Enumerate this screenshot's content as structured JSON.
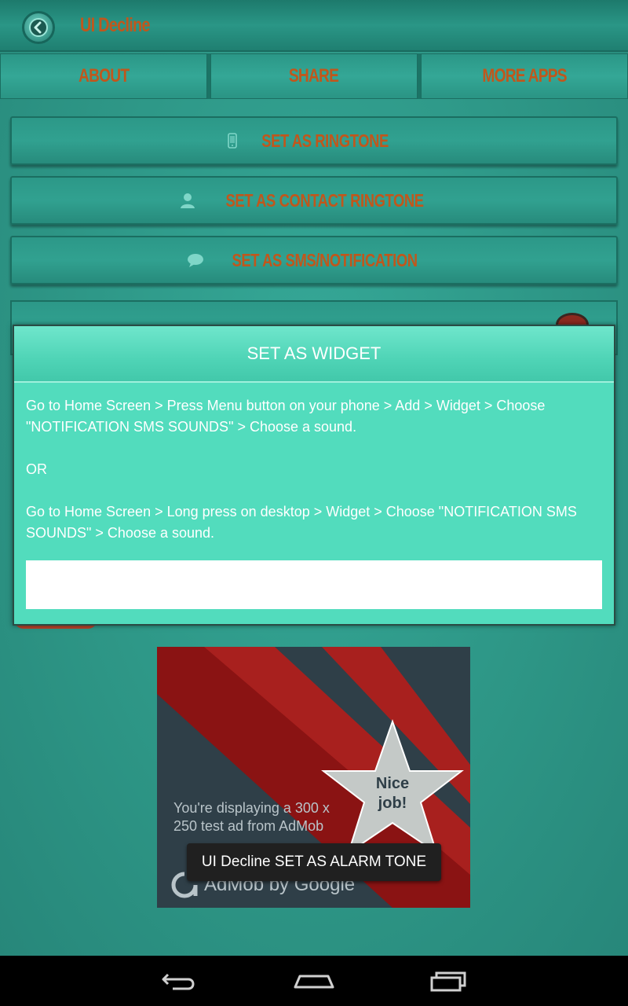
{
  "app": {
    "title": "UI Decline"
  },
  "tabs": [
    {
      "label": "ABOUT"
    },
    {
      "label": "SHARE"
    },
    {
      "label": "MORE APPS"
    }
  ],
  "actions": {
    "ringtone": "SET AS RINGTONE",
    "contact_ringtone": "SET AS CONTACT RINGTONE",
    "sms_notification": "SET AS SMS/NOTIFICATION"
  },
  "dialog": {
    "title": "SET AS WIDGET",
    "paragraph1": "Go to Home Screen > Press Menu button on your phone > Add > Widget > Choose \"NOTIFICATION SMS SOUNDS\" > Choose a sound.",
    "or_text": "OR",
    "paragraph2": "Go to Home Screen > Long press on desktop > Widget > Choose \"NOTIFICATION SMS SOUNDS\" > Choose a sound.",
    "input_value": ""
  },
  "ad": {
    "text": "You're displaying a 300 x 250 test ad from AdMob",
    "star_text_line1": "Nice",
    "star_text_line2": "job!",
    "brand": "AdMob by Google"
  },
  "toast": {
    "message": "UI Decline SET AS ALARM TONE"
  },
  "colors": {
    "accent_orange": "#c0571c",
    "teal_bg": "#2f9c8c",
    "dialog_bg": "#52dcbd"
  }
}
